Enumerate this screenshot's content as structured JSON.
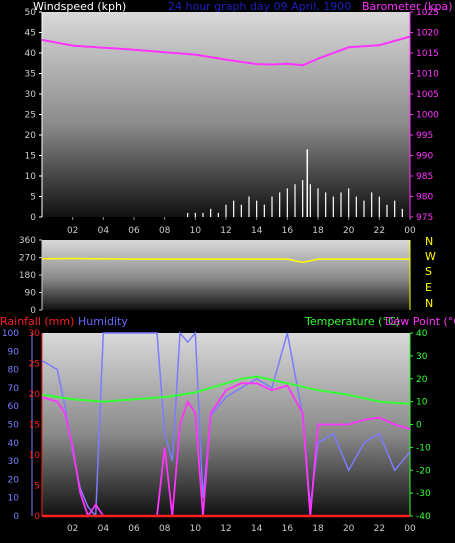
{
  "colors": {
    "wind": "#ffffff",
    "gust": "#ffffff",
    "wind_axis": "#ffffff",
    "barometer": "#ff33ff",
    "direction": "#ffff00",
    "compass": "#ffff00",
    "rain": "#ff2020",
    "rain_axis": "#ff2020",
    "humidity": "#7c7cff",
    "humidity_text": "#6a6aff",
    "temperature": "#33ff33",
    "dewpoint": "#ff33ff",
    "title": "#2020c0",
    "axis_text": "#cccccc"
  },
  "top": {
    "title": "24 hour graph day   09 April, 1900",
    "left_title": "Windspeed (kph)",
    "right_title": "Barometer (kpa)"
  },
  "compass": {
    "labels": [
      "N",
      "W",
      "S",
      "E",
      "N"
    ]
  },
  "bottom": {
    "rain_title": "Rainfall (mm)",
    "humidity_title": "Humidity",
    "temp_title": "Temperature (°C)",
    "dew_title": "Dew Point (°C)"
  },
  "chart_data": [
    {
      "type": "line",
      "title": "24 hour graph day   09 April, 1900",
      "xlabel": "",
      "x_ticks": [
        "02",
        "04",
        "06",
        "08",
        "10",
        "12",
        "14",
        "16",
        "18",
        "20",
        "22",
        "00"
      ],
      "x_range_hours": [
        0,
        24
      ],
      "y_left": {
        "label": "Windspeed (kph)",
        "range": [
          0,
          50
        ],
        "ticks": [
          0,
          5,
          10,
          15,
          20,
          25,
          30,
          35,
          40,
          45,
          50
        ]
      },
      "y_right": {
        "label": "Barometer (kpa)",
        "range": [
          975,
          1025
        ],
        "ticks": [
          975,
          980,
          985,
          990,
          995,
          1000,
          1005,
          1010,
          1015,
          1020,
          1025
        ]
      },
      "series": [
        {
          "name": "Barometer (kpa)",
          "axis": "right",
          "x": [
            0,
            2,
            4,
            6,
            8,
            10,
            12,
            14,
            15,
            16,
            17,
            18,
            20,
            22,
            24
          ],
          "y": [
            1018.2,
            1016.8,
            1016.3,
            1015.8,
            1015.2,
            1014.6,
            1013.4,
            1012.3,
            1012.2,
            1012.4,
            1012.0,
            1013.6,
            1016.4,
            1016.9,
            1019.0
          ]
        },
        {
          "name": "Windspeed (kph)",
          "axis": "left",
          "x": [
            9.5,
            10,
            10.5,
            11,
            11.5,
            12,
            12.5,
            13,
            13.5,
            14,
            14.5,
            15,
            15.5,
            16,
            16.5,
            17,
            17.5,
            18,
            18.5,
            19,
            19.5,
            20,
            20.5,
            21,
            21.5,
            22,
            22.5,
            23,
            23.5
          ],
          "y": [
            1,
            1,
            1,
            2,
            1,
            3,
            4,
            3,
            5,
            4,
            3,
            5,
            6,
            7,
            8,
            9,
            8,
            7,
            6,
            5,
            6,
            7,
            5,
            4,
            6,
            5,
            3,
            4,
            2
          ]
        },
        {
          "name": "Gust (kph)",
          "axis": "left",
          "x": [
            17.3
          ],
          "y": [
            16.5
          ]
        }
      ]
    },
    {
      "type": "line",
      "x_range_hours": [
        0,
        24
      ],
      "y_left": {
        "range": [
          0,
          360
        ],
        "ticks": [
          0,
          90,
          180,
          270,
          360
        ]
      },
      "series": [
        {
          "name": "Wind direction",
          "x": [
            0,
            2,
            4,
            6,
            8,
            10,
            12,
            14,
            16,
            17,
            18,
            20,
            22,
            24
          ],
          "y": [
            264,
            265,
            263,
            262,
            262,
            262,
            262,
            262,
            262,
            245,
            262,
            262,
            262,
            262
          ]
        }
      ]
    },
    {
      "type": "line",
      "x_range_hours": [
        0,
        24
      ],
      "y_left": {
        "label": "Rainfall (mm)",
        "range": [
          0,
          30
        ],
        "ticks": [
          0,
          5,
          10,
          15,
          20,
          25,
          30
        ]
      },
      "y_left2": {
        "label": "Humidity",
        "range": [
          0,
          100
        ],
        "ticks": [
          0,
          10,
          20,
          30,
          40,
          50,
          60,
          70,
          80,
          90,
          100
        ]
      },
      "y_right": {
        "label": "Temperature (°C)",
        "range": [
          -40,
          40
        ],
        "ticks": [
          -40,
          -30,
          -20,
          -10,
          0,
          10,
          20,
          30,
          40
        ]
      },
      "series": [
        {
          "name": "Temperature (°C)",
          "axis": "right",
          "x": [
            0,
            2,
            4,
            6,
            8,
            10,
            12,
            13,
            14,
            16,
            18,
            20,
            22,
            24
          ],
          "y": [
            13,
            11,
            10,
            11,
            12,
            14,
            18,
            20,
            21,
            18,
            15,
            13,
            10,
            9
          ]
        },
        {
          "name": "Dew Point (°C)",
          "axis": "right",
          "x": [
            0,
            1,
            1.5,
            2,
            2.5,
            3,
            3.5,
            4,
            6,
            7.5,
            8,
            8.5,
            9,
            9.5,
            10,
            10.5,
            11,
            12,
            13,
            14,
            15,
            16,
            17,
            17.5,
            18,
            19,
            20,
            21,
            22,
            23,
            24
          ],
          "y": [
            12,
            10,
            5,
            -10,
            -30,
            -40,
            -35,
            -40,
            -40,
            -40,
            -10,
            -40,
            0,
            10,
            5,
            -40,
            5,
            15,
            18,
            18,
            15,
            17,
            5,
            -40,
            0,
            0,
            0,
            2,
            3,
            0,
            -2
          ]
        },
        {
          "name": "Humidity",
          "axis": "left2",
          "x": [
            0,
            1,
            1.5,
            2,
            2.5,
            3,
            3.5,
            4,
            6,
            7.5,
            8,
            8.5,
            9,
            9.5,
            10,
            10.5,
            11,
            12,
            13,
            14,
            15,
            16,
            17,
            17.5,
            18,
            19,
            20,
            21,
            22,
            23,
            24
          ],
          "y": [
            85,
            80,
            60,
            35,
            15,
            5,
            0,
            100,
            100,
            100,
            45,
            30,
            100,
            95,
            100,
            10,
            55,
            65,
            70,
            75,
            70,
            100,
            55,
            5,
            40,
            45,
            25,
            40,
            45,
            25,
            35
          ]
        },
        {
          "name": "Rainfall (mm)",
          "axis": "left",
          "x": [
            0,
            24
          ],
          "y": [
            0,
            0
          ]
        }
      ]
    }
  ]
}
